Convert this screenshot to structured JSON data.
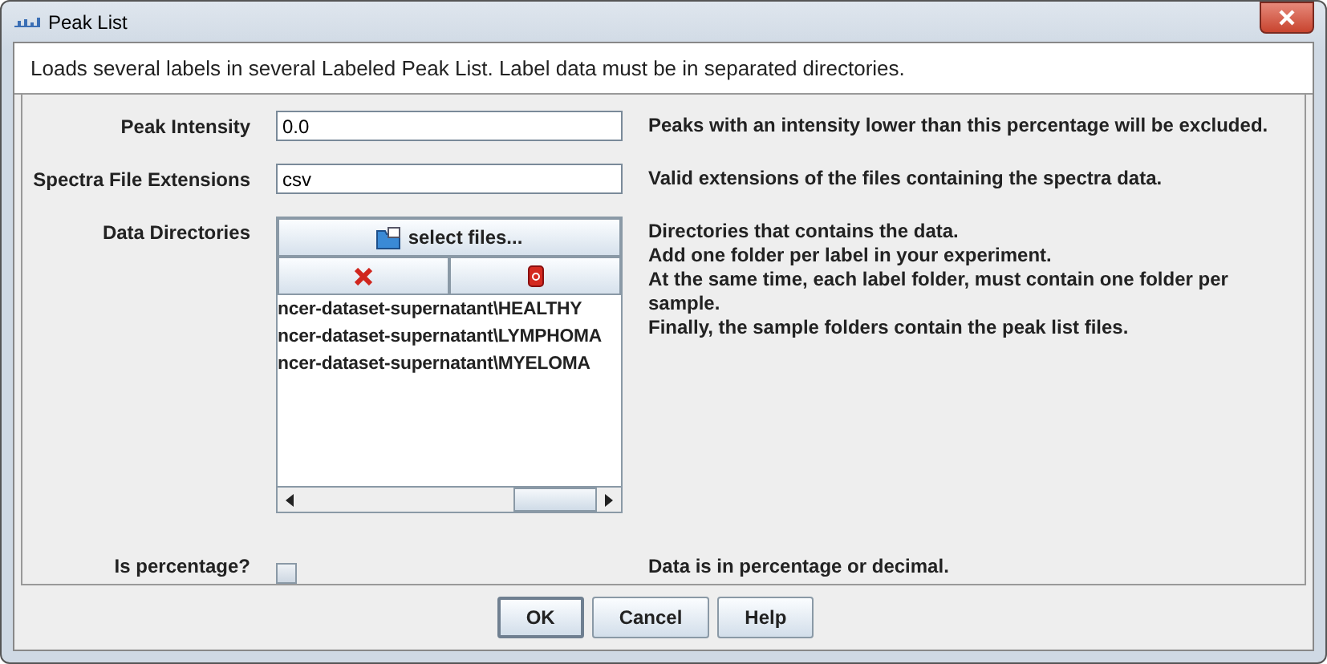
{
  "window": {
    "title": "Peak List"
  },
  "description": "Loads several labels in several Labeled Peak List. Label data must be in separated directories.",
  "params": [
    {
      "kind": "text",
      "label": "Peak Intensity",
      "value": "0.0",
      "help": [
        "Peaks with an intensity lower than this percentage will be excluded."
      ]
    },
    {
      "kind": "text",
      "label": "Spectra File Extensions",
      "value": "csv",
      "help": [
        "Valid extensions of the files containing the spectra data."
      ]
    },
    {
      "kind": "files",
      "label": "Data Directories",
      "select_button": "select files...",
      "items": [
        "ncer-dataset-supernatant\\HEALTHY",
        "ncer-dataset-supernatant\\LYMPHOMA",
        "ncer-dataset-supernatant\\MYELOMA"
      ],
      "help": [
        "Directories that contains the data.",
        "Add one folder per label in your experiment.",
        "At the same time, each label folder, must contain one folder per sample.",
        "Finally, the sample folders contain the peak list files."
      ]
    },
    {
      "kind": "checkbox",
      "label": "Is percentage?",
      "checked": false,
      "help": [
        "Data is in percentage or decimal."
      ]
    }
  ],
  "buttons": [
    {
      "label": "OK",
      "selected": true
    },
    {
      "label": "Cancel",
      "selected": false
    },
    {
      "label": "Help",
      "selected": false
    }
  ]
}
